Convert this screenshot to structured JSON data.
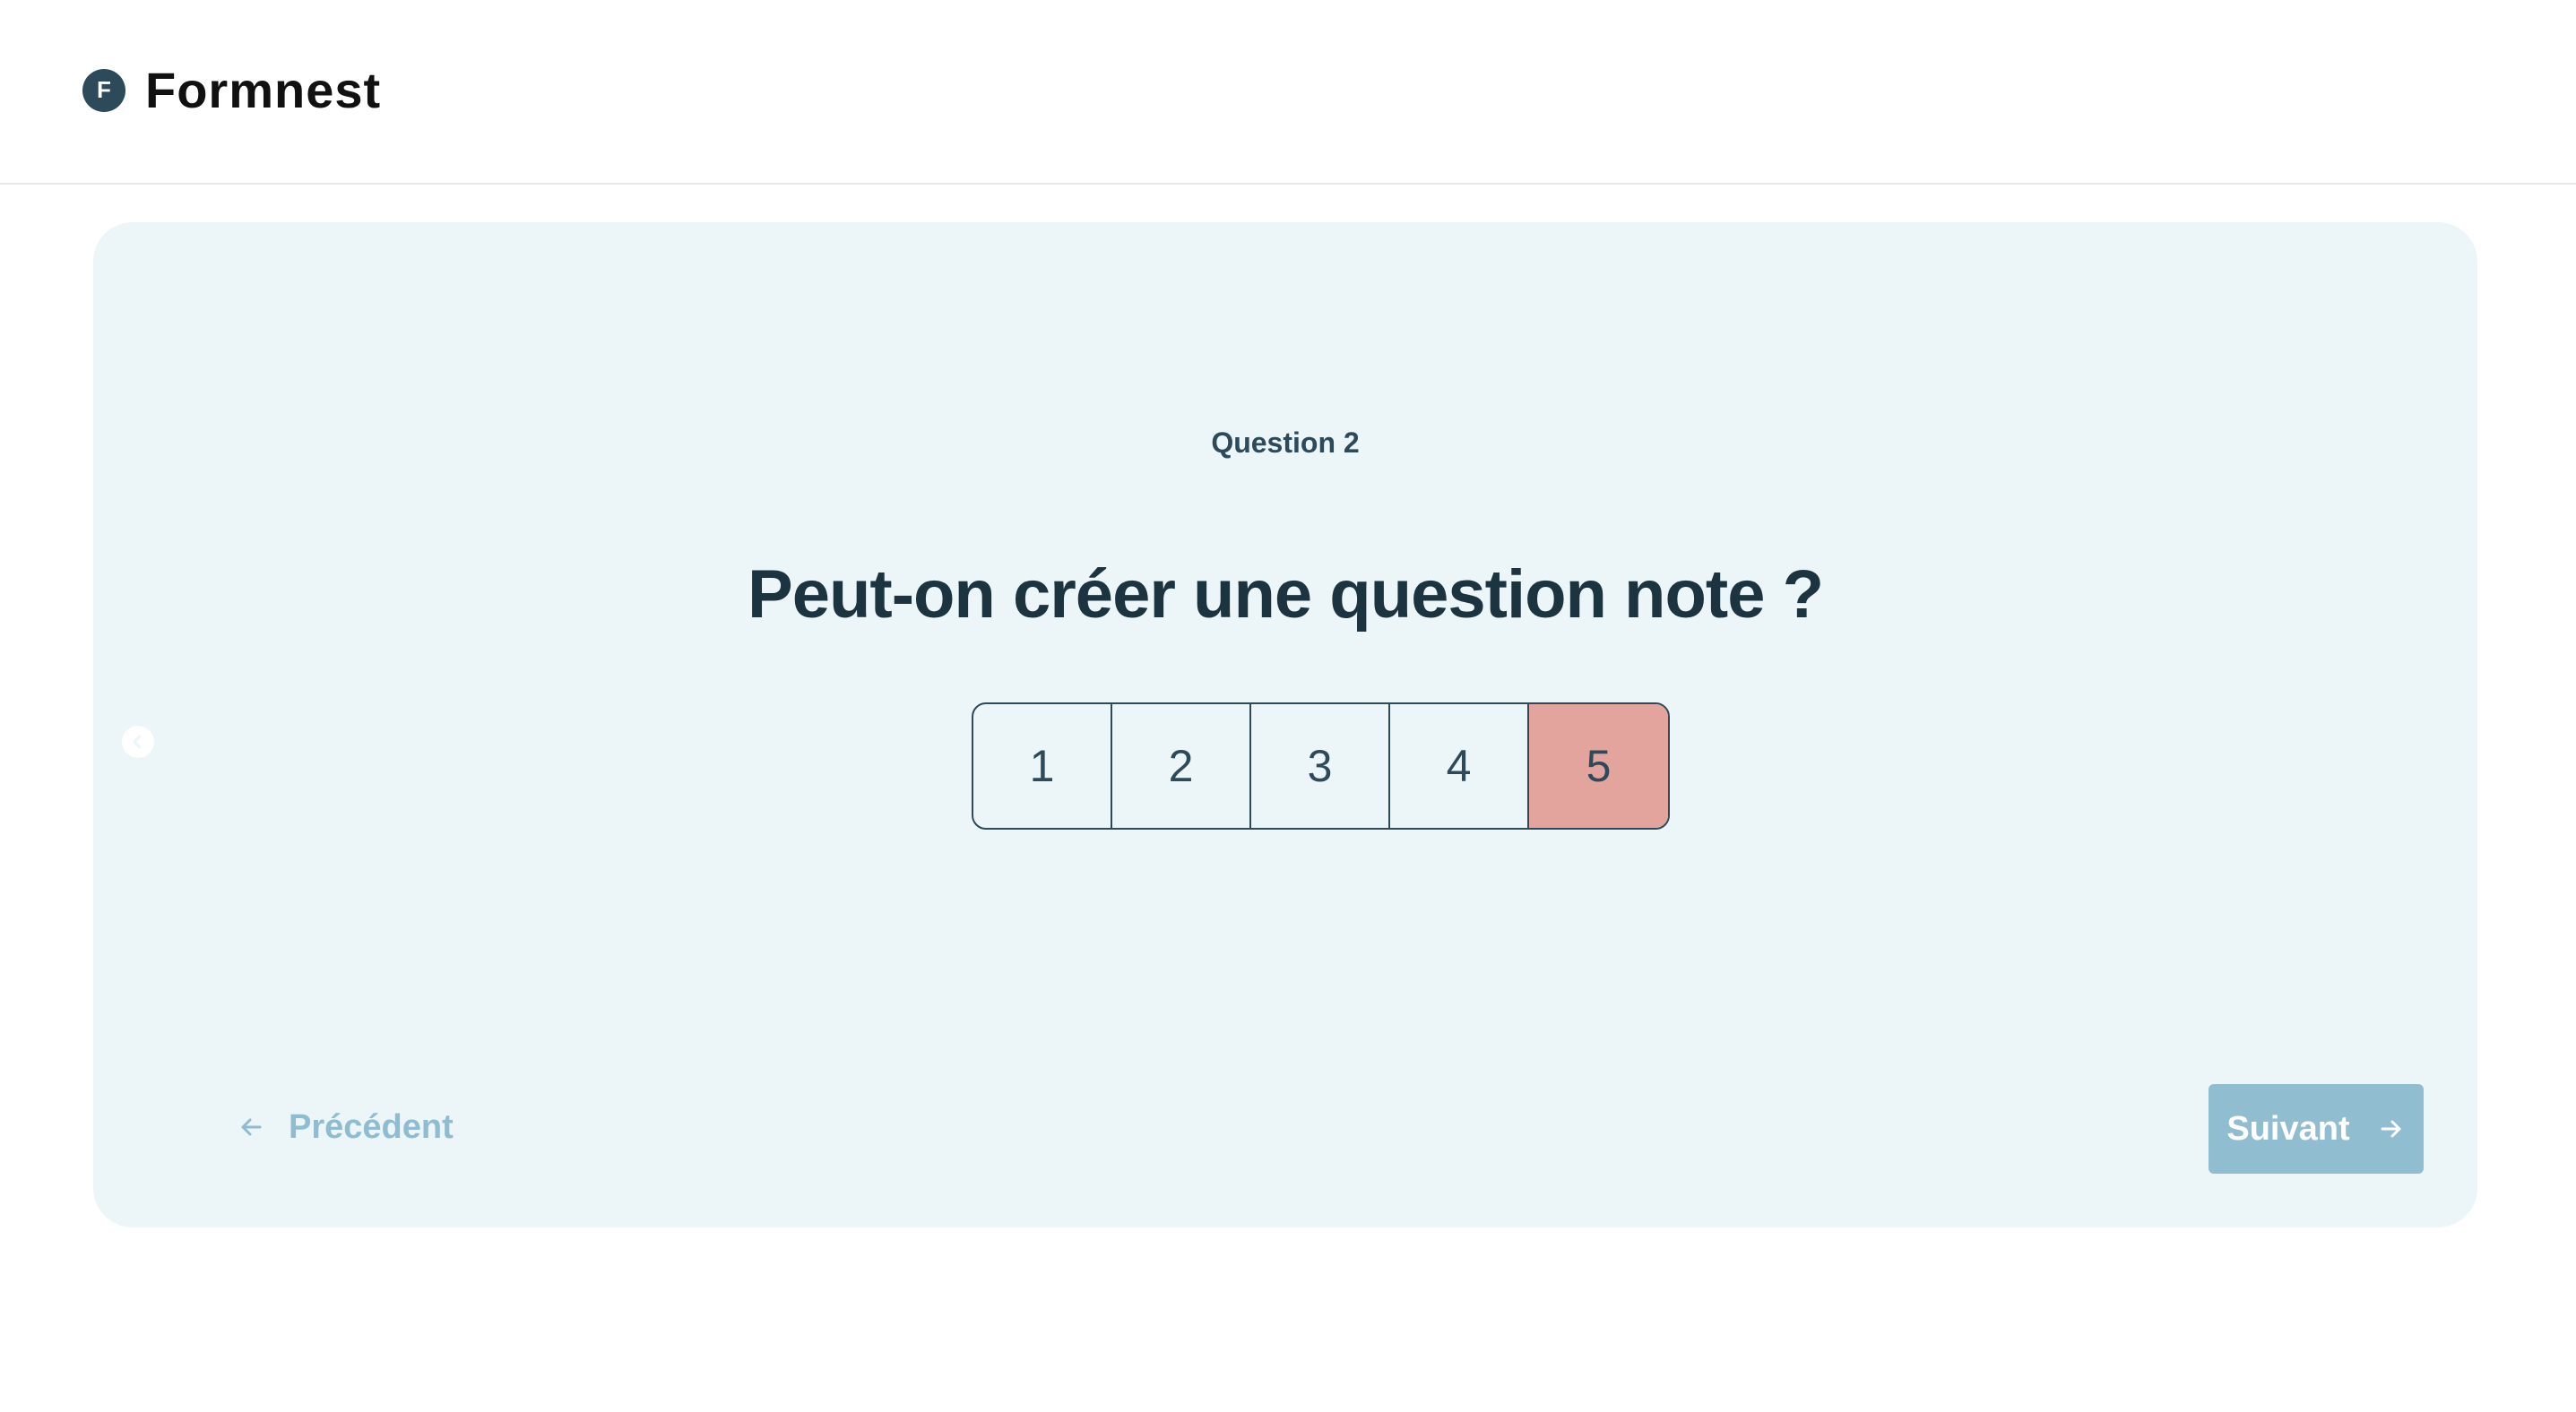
{
  "header": {
    "logo_letter": "F",
    "brand": "Formnest"
  },
  "question": {
    "label": "Question 2",
    "title": "Peut-on créer une question note ?",
    "scale": [
      "1",
      "2",
      "3",
      "4",
      "5"
    ],
    "selected_value": 5
  },
  "navigation": {
    "prev_label": "Précédent",
    "next_label": "Suivant"
  },
  "icons": {
    "side": "chevron-left-icon",
    "prev": "arrow-left-icon",
    "next": "arrow-right-icon"
  },
  "colors": {
    "card_background": "#ecf5f8",
    "brand_dark": "#2d4a5a",
    "selected_option": "#e2a49d",
    "next_button": "#91bdd0",
    "prev_link": "#8fbcd0"
  }
}
